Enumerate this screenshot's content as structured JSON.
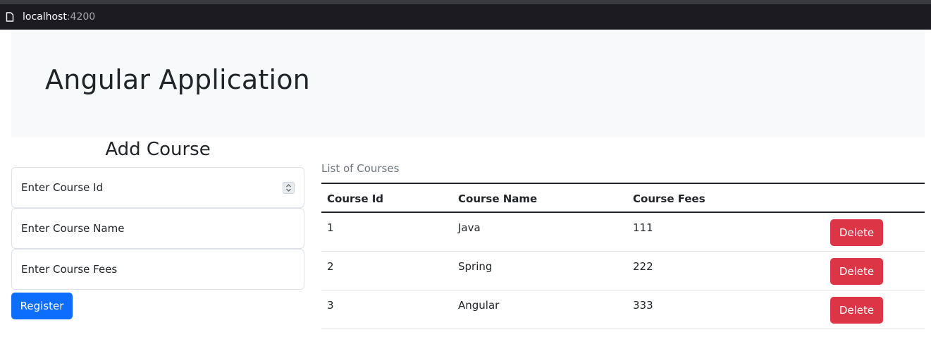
{
  "browser": {
    "url_host": "localhost",
    "url_port": ":4200"
  },
  "header": {
    "title": "Angular Application"
  },
  "form": {
    "title": "Add Course",
    "course_id_placeholder": "Enter Course Id",
    "course_name_placeholder": "Enter Course Name",
    "course_fees_placeholder": "Enter Course Fees",
    "register_label": "Register"
  },
  "table": {
    "caption": "List of Courses",
    "headers": [
      "Course Id",
      "Course Name",
      "Course Fees"
    ],
    "rows": [
      {
        "id": "1",
        "name": "Java",
        "fees": "111",
        "action": "Delete"
      },
      {
        "id": "2",
        "name": "Spring",
        "fees": "222",
        "action": "Delete"
      },
      {
        "id": "3",
        "name": "Angular",
        "fees": "333",
        "action": "Delete"
      }
    ]
  },
  "colors": {
    "primary": "#0d6efd",
    "danger": "#dc3545",
    "jumbotron_bg": "#f8f9fa"
  },
  "icons": {
    "page": "page-icon",
    "spinner": "number-spinner-icon"
  }
}
